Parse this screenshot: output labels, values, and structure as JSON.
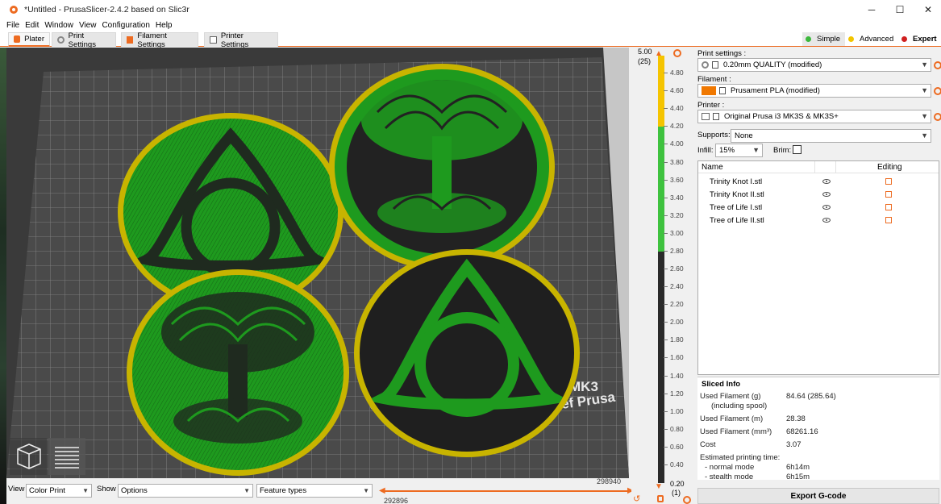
{
  "window": {
    "title": "*Untitled - PrusaSlicer-2.4.2 based on Slic3r",
    "minimize": "─",
    "maximize": "☐",
    "close": "✕"
  },
  "menu": [
    "File",
    "Edit",
    "Window",
    "View",
    "Configuration",
    "Help"
  ],
  "tabs": [
    {
      "label": "Plater",
      "icon": "plater-icon",
      "active": true
    },
    {
      "label": "Print Settings",
      "icon": "cog-icon",
      "active": false
    },
    {
      "label": "Filament Settings",
      "icon": "spool-icon",
      "active": false
    },
    {
      "label": "Printer Settings",
      "icon": "printer-icon",
      "active": false
    }
  ],
  "modes": [
    {
      "label": "Simple",
      "color": "#3cb83c"
    },
    {
      "label": "Advanced",
      "color": "#f2c500"
    },
    {
      "label": "Expert",
      "color": "#d02020"
    }
  ],
  "viewport": {
    "bed_label_1": "MK3",
    "bed_label_2": "Josef Prusa",
    "bed_label_partial": "O"
  },
  "bottom_bar": {
    "view_label": "View",
    "view_value": "Color Print",
    "show_label": "Show",
    "show_value": "Options",
    "feature_value": "Feature types",
    "h_slider_max": "298940",
    "h_slider_min": "292896"
  },
  "vertical_slider": {
    "top_value": "5.00",
    "top_layer": "(25)",
    "bottom_value": "0.20",
    "bottom_layer": "(1)",
    "ticks": [
      "4.80",
      "4.60",
      "4.40",
      "4.20",
      "4.00",
      "3.80",
      "3.60",
      "3.40",
      "3.20",
      "3.00",
      "2.80",
      "2.60",
      "2.40",
      "2.20",
      "2.00",
      "1.80",
      "1.60",
      "1.40",
      "1.20",
      "1.00",
      "0.80",
      "0.60",
      "0.40"
    ],
    "color_bands": [
      {
        "from": 4.2,
        "to": 5.0,
        "color": "#f5c400"
      },
      {
        "from": 2.8,
        "to": 4.2,
        "color": "#3ec23e"
      },
      {
        "from": 0.2,
        "to": 2.8,
        "color": "#2a2a2a"
      }
    ]
  },
  "panel": {
    "print_settings_label": "Print settings :",
    "print_settings_value": "0.20mm QUALITY (modified)",
    "filament_label": "Filament :",
    "filament_value": "Prusament PLA (modified)",
    "filament_color": "#f07800",
    "printer_label": "Printer :",
    "printer_value": "Original Prusa i3 MK3S & MK3S+",
    "supports_label": "Supports:",
    "supports_value": "None",
    "infill_label": "Infill:",
    "infill_value": "15%",
    "brim_label": "Brim:",
    "list_header_name": "Name",
    "list_header_editing": "Editing",
    "objects": [
      "Trinity Knot I.stl",
      "Trinity Knot II.stl",
      "Tree of Life I.stl",
      "Tree of Life II.stl"
    ],
    "sliced_title": "Sliced Info",
    "sliced_rows": [
      {
        "label": "Used Filament (g)",
        "value": "84.64 (285.64)"
      },
      {
        "label": "(including spool)",
        "value": ""
      },
      {
        "label": "Used Filament (m)",
        "value": "28.38"
      },
      {
        "label": "Used Filament (mm³)",
        "value": "68261.16"
      },
      {
        "label": "Cost",
        "value": "3.07"
      },
      {
        "label": "Estimated printing time:",
        "value": ""
      },
      {
        "label": "- normal mode",
        "value": "6h14m"
      },
      {
        "label": "- stealth mode",
        "value": "6h15m"
      }
    ],
    "export_label": "Export G-code"
  }
}
